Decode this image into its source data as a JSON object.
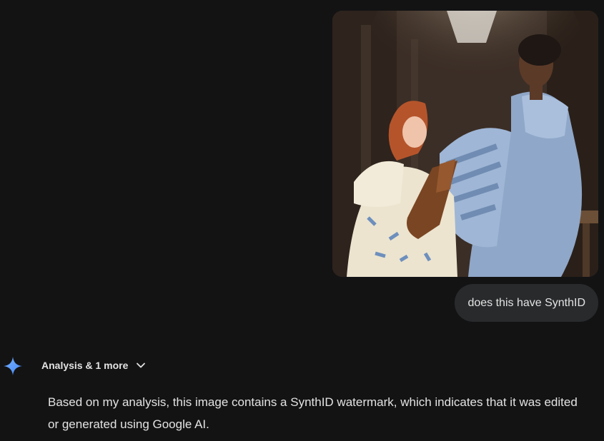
{
  "conversation": {
    "user_message": {
      "image": {
        "icon": "attached-painting-image"
      },
      "text": "does this have SynthID"
    },
    "model_response": {
      "icon": "gemini-spark-icon",
      "accent_colors": [
        "#4285f4",
        "#7ab4ff"
      ],
      "tools_label": "Analysis & 1 more",
      "tools_icon": "chevron-down-icon",
      "text": "Based on my analysis, this image contains a SynthID watermark, which indicates that it was edited or generated using Google AI."
    }
  }
}
